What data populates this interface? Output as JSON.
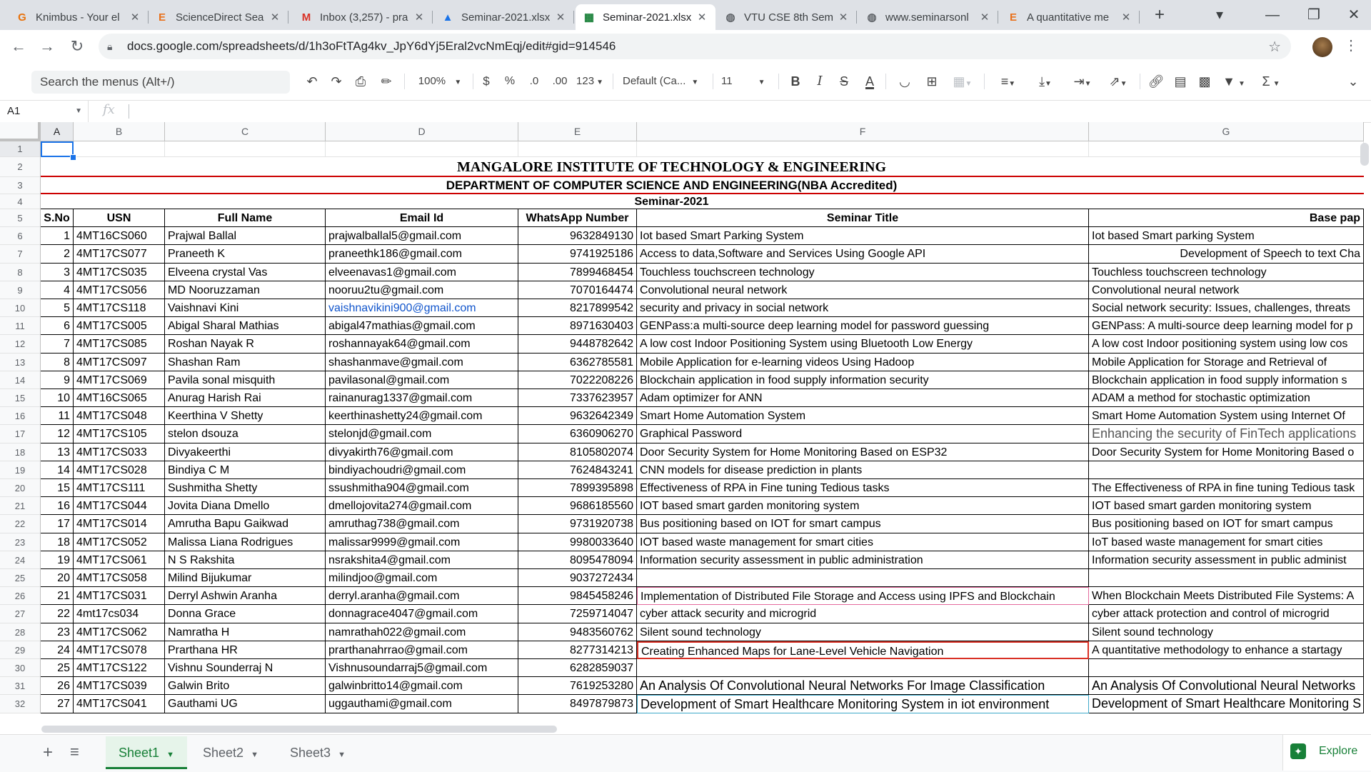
{
  "browser": {
    "tabs": [
      {
        "title": "Knimbus - Your el",
        "icon": "knimbus-icon",
        "color": "#e8710a",
        "glyph": "G"
      },
      {
        "title": "ScienceDirect Sea",
        "icon": "elsevier-icon",
        "color": "#e9711c",
        "glyph": "E"
      },
      {
        "title": "Inbox (3,257) - pra",
        "icon": "gmail-icon",
        "color": "#d93025",
        "glyph": "M"
      },
      {
        "title": "Seminar-2021.xlsx",
        "icon": "drive-icon",
        "color": "#1a73e8",
        "glyph": "▲"
      },
      {
        "title": "Seminar-2021.xlsx",
        "icon": "sheets-icon",
        "color": "#188038",
        "glyph": "▦",
        "active": true
      },
      {
        "title": "VTU CSE 8th Sem",
        "icon": "globe-icon",
        "color": "#5f6368",
        "glyph": "◍"
      },
      {
        "title": "www.seminarsonl",
        "icon": "globe-icon",
        "color": "#5f6368",
        "glyph": "◍"
      },
      {
        "title": "A quantitative me",
        "icon": "elsevier-icon",
        "color": "#e9711c",
        "glyph": "E"
      }
    ],
    "new_tab": "+",
    "url": "docs.google.com/spreadsheets/d/1h3oFtTAg4kv_JpY6dYj5Eral2vcNmEqj/edit#gid=914546"
  },
  "toolbar": {
    "search_placeholder": "Search the menus (Alt+/)",
    "zoom": "100%",
    "currency": "$",
    "percent": "%",
    "dec_decrease": ".0",
    "dec_increase": ".00",
    "format_more": "123",
    "font": "Default (Ca...",
    "font_size": "11"
  },
  "formula_bar": {
    "cell_ref": "A1",
    "fx": "fx",
    "value": ""
  },
  "columns": [
    "A",
    "B",
    "C",
    "D",
    "E",
    "F",
    "G"
  ],
  "header_rows": {
    "title": "MANGALORE INSTITUTE OF TECHNOLOGY & ENGINEERING",
    "dept": "DEPARTMENT OF COMPUTER SCIENCE AND ENGINEERING(NBA Accredited)",
    "seminar": "Seminar-2021"
  },
  "table_headers": [
    "S.No",
    "USN",
    "Full Name",
    "Email Id",
    "WhatsApp Number",
    "Seminar Title",
    "Base pap"
  ],
  "rows": [
    [
      "1",
      "4MT16CS060",
      "Prajwal Ballal",
      "prajwalballal5@gmail.com",
      "9632849130",
      "Iot based Smart Parking System",
      "Iot based Smart parking System"
    ],
    [
      "2",
      "4MT17CS077",
      "Praneeth K",
      "praneethk186@gmail.com",
      "9741925186",
      "Access to data,Software and Services Using Google API",
      "Development of Speech to text Cha"
    ],
    [
      "3",
      "4MT17CS035",
      "Elveena crystal Vas",
      "elveenavas1@gmail.com",
      "7899468454",
      "Touchless touchscreen technology",
      "Touchless touchscreen technology"
    ],
    [
      "4",
      "4MT17CS056",
      "MD Nooruzzaman",
      "nooruu2tu@gmail.com",
      "7070164474",
      "Convolutional neural network",
      "Convolutional neural network"
    ],
    [
      "5",
      "4MT17CS118",
      "Vaishnavi Kini",
      "vaishnavikini900@gmail.com",
      "8217899542",
      "security and privacy in social network",
      "Social network security: Issues, challenges, threats"
    ],
    [
      "6",
      "4MT17CS005",
      "Abigal Sharal Mathias",
      "abigal47mathias@gmail.com",
      "8971630403",
      "GENPass:a multi-source deep learning model for password guessing",
      "GENPass: A multi-source deep learning model for p"
    ],
    [
      "7",
      "4MT17CS085",
      "Roshan Nayak R",
      "roshannayak64@gmail.com",
      "9448782642",
      "A low cost Indoor Positioning System using Bluetooth Low Energy",
      "A low cost Indoor positioning system using low cos"
    ],
    [
      "8",
      "4MT17CS097",
      "Shashan Ram",
      "shashanmave@gmail.com",
      "6362785581",
      "Mobile  Application  for  e-learning  videos  Using  Hadoop",
      "Mobile  Application  for  Storage  and  Retrieval  of"
    ],
    [
      "9",
      "4MT17CS069",
      "Pavila sonal misquith",
      "pavilasonal@gmail.com",
      "7022208226",
      "Blockchain application in food supply information security",
      "Blockchain application in food supply information s"
    ],
    [
      "10",
      "4MT16CS065",
      "Anurag Harish Rai",
      "rainanurag1337@gmail.com",
      "7337623957",
      "Adam optimizer for ANN",
      "ADAM a method for stochastic optimization"
    ],
    [
      "11",
      "4MT17CS048",
      "Keerthina V Shetty",
      "keerthinashetty24@gmail.com",
      "9632642349",
      "Smart Home Automation System",
      "Smart Home Automation System using Internet Of"
    ],
    [
      "12",
      "4MT17CS105",
      "stelon dsouza",
      "stelonjd@gmail.com",
      "6360906270",
      "Graphical Password",
      "Enhancing the security of FinTech applications"
    ],
    [
      "13",
      "4MT17CS033",
      "Divyakeerthi",
      "divyakirth76@gmail.com",
      "8105802074",
      "Door Security System for Home Monitoring Based on ESP32",
      "Door Security System for Home Monitoring Based o"
    ],
    [
      "14",
      "4MT17CS028",
      "Bindiya C M",
      "bindiyachoudri@gmail.com",
      "7624843241",
      "CNN models for disease prediction in plants",
      ""
    ],
    [
      "15",
      "4MT17CS111",
      "Sushmitha Shetty",
      "ssushmitha904@gmail.com",
      "7899395898",
      "Effectiveness of RPA in Fine tuning Tedious tasks",
      "The Effectiveness of RPA in fine tuning Tedious task"
    ],
    [
      "16",
      "4MT17CS044",
      "Jovita Diana Dmello",
      "dmellojovita274@gmail.com",
      "9686185560",
      "IOT based smart garden monitoring system",
      "IOT based smart garden monitoring system"
    ],
    [
      "17",
      "4MT17CS014",
      "Amrutha Bapu Gaikwad",
      "amruthag738@gmail.com",
      "9731920738",
      "Bus positioning based on IOT for smart campus",
      "Bus positioning based on IOT for smart campus"
    ],
    [
      "18",
      "4MT17CS052",
      "Malissa Liana Rodrigues",
      "malissar9999@gmail.com",
      "9980033640",
      "IOT based waste management for smart cities",
      "IoT based waste management for smart cities"
    ],
    [
      "19",
      "4MT17CS061",
      "N S Rakshita",
      "nsrakshita4@gmail.com",
      "8095478094",
      "Information security assessment in public administration",
      "Information security assessment in public administ"
    ],
    [
      "20",
      "4MT17CS058",
      "Milind Bijukumar",
      "milindjoo@gmail.com",
      "9037272434",
      "",
      ""
    ],
    [
      "21",
      "4MT17CS031",
      "Derryl Ashwin Aranha",
      "derryl.aranha@gmail.com",
      "9845458246",
      "Implementation of Distributed File Storage and Access using IPFS and Blockchain",
      "When Blockchain Meets Distributed File Systems: A"
    ],
    [
      "22",
      "4mt17cs034",
      "Donna Grace",
      "donnagrace4047@gmail.com",
      "7259714047",
      "cyber attack security and microgrid",
      "cyber attack protection and control of microgrid"
    ],
    [
      "23",
      "4MT17CS062",
      "Namratha H",
      "namrathah022@gmail.com",
      "9483560762",
      "Silent sound technology",
      "Silent sound technology"
    ],
    [
      "24",
      "4MT17CS078",
      "Prarthana HR",
      "prarthanahrrao@gmail.com",
      "8277314213",
      "Creating Enhanced Maps for Lane-Level Vehicle Navigation",
      "A quantitative methodology to enhance a startagy"
    ],
    [
      "25",
      "4MT17CS122",
      "Vishnu Sounderraj N",
      "Vishnusoundarraj5@gmail.com",
      "6282859037",
      "",
      ""
    ],
    [
      "26",
      "4MT17CS039",
      "Galwin Brito",
      "galwinbritto14@gmail.com",
      "7619253280",
      "An Analysis Of Convolutional Neural Networks For Image Classification",
      "An Analysis Of Convolutional Neural Networks"
    ],
    [
      "27",
      "4MT17CS041",
      "Gauthami UG",
      "uggauthami@gmail.com",
      "8497879873",
      "Development of Smart Healthcare Monitoring System in iot environment",
      "Development of Smart Healthcare Monitoring S"
    ]
  ],
  "sheets": [
    "Sheet1",
    "Sheet2",
    "Sheet3"
  ],
  "explore_label": "Explore",
  "colors": {
    "accent_blue": "#1a73e8",
    "sheets_green": "#188038",
    "link_blue": "#1155cc",
    "title_red": "#cc0000"
  }
}
